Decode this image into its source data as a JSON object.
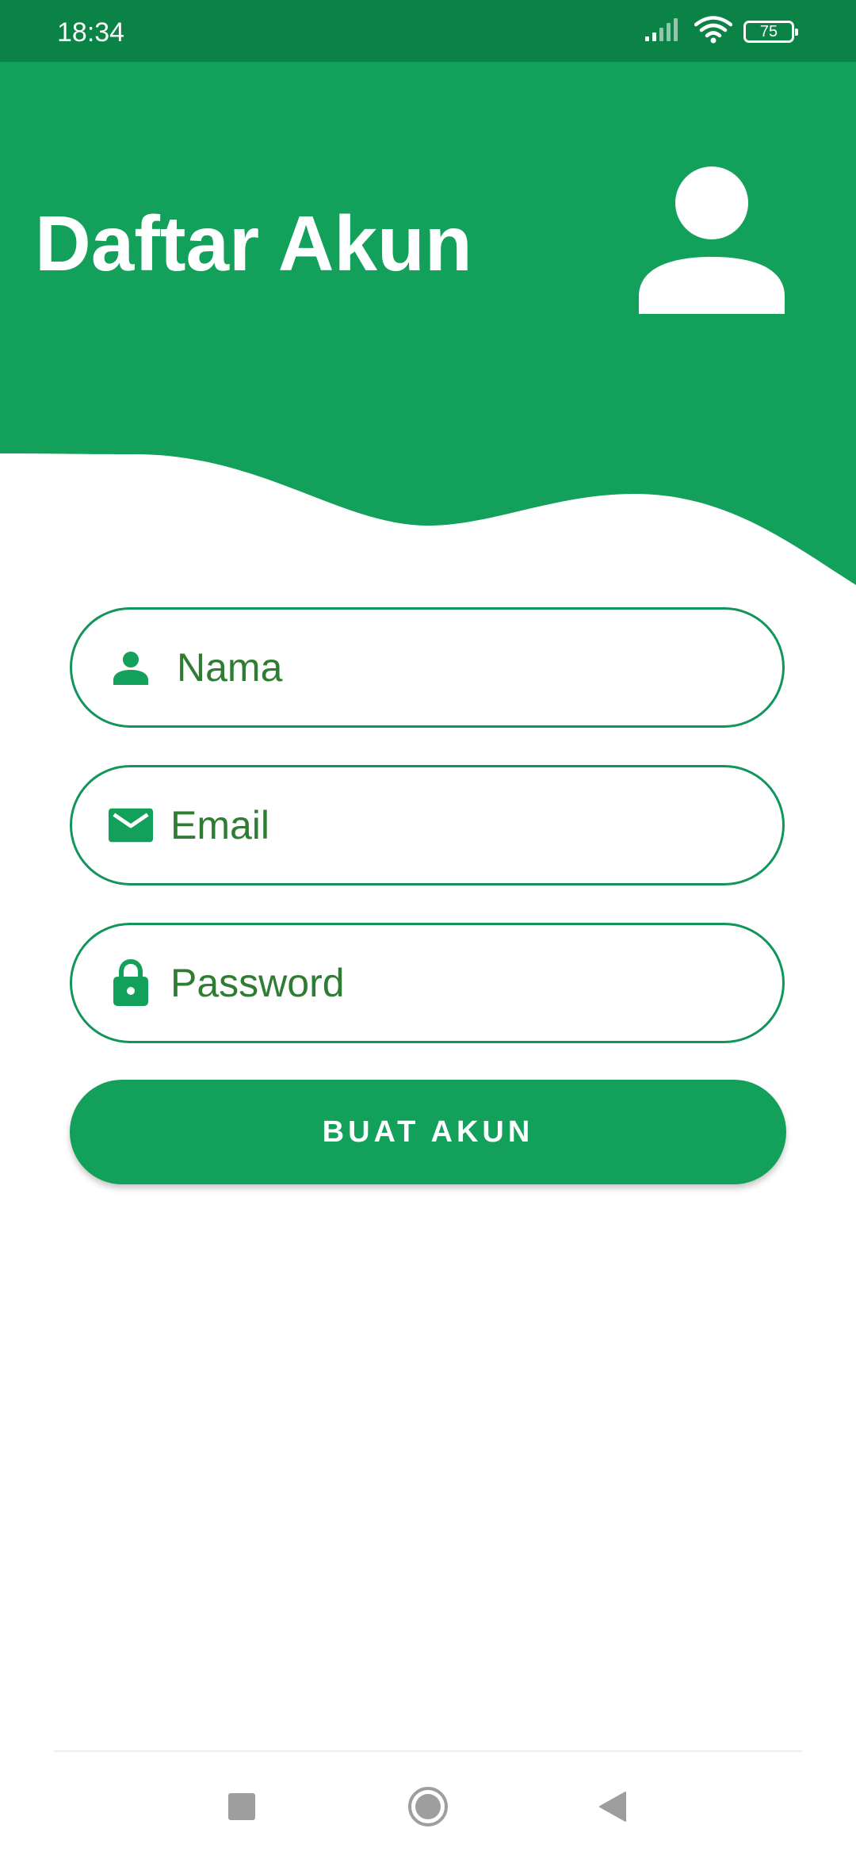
{
  "status_bar": {
    "time": "18:34",
    "battery_level": "75",
    "icons": [
      "signal-icon",
      "wifi-icon",
      "battery-icon"
    ]
  },
  "header": {
    "title": "Daftar Akun",
    "avatar_icon": "person-icon"
  },
  "form": {
    "name_field": {
      "placeholder": "Nama",
      "value": "",
      "icon": "person-icon"
    },
    "email_field": {
      "placeholder": "Email",
      "value": "",
      "icon": "email-icon"
    },
    "password_field": {
      "placeholder": "Password",
      "value": "",
      "icon": "lock-icon"
    },
    "submit_label": "BUAT AKUN"
  },
  "navigation_bar": {
    "buttons": [
      "recent-apps-icon",
      "home-icon",
      "back-icon"
    ]
  },
  "colors": {
    "status_bar": "#0b8246",
    "primary": "#12a05a",
    "field_border": "#12955a",
    "field_text": "#2e7d32",
    "background": "#ffffff"
  }
}
